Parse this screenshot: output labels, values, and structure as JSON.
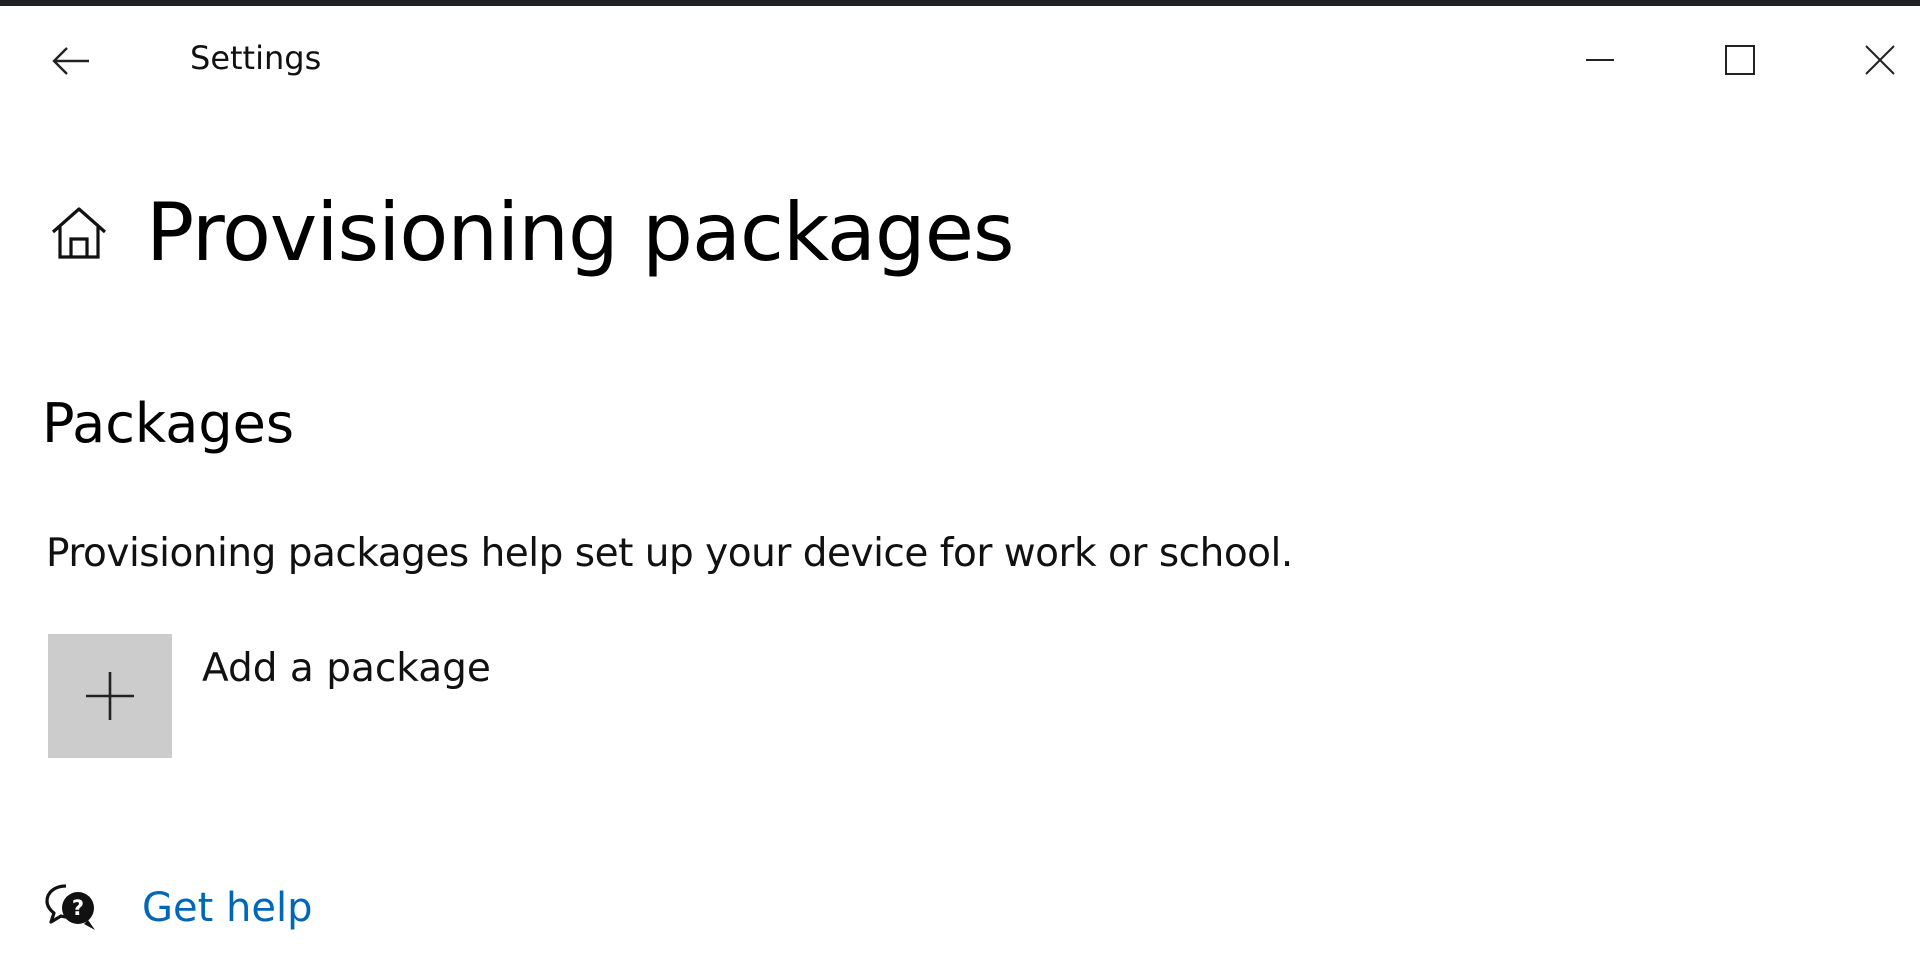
{
  "window": {
    "title": "Settings",
    "controls": {
      "minimize": "minimize-icon",
      "maximize": "maximize-icon",
      "close": "close-icon"
    }
  },
  "header": {
    "title": "Provisioning packages",
    "home_icon": "home-icon"
  },
  "section": {
    "title": "Packages",
    "description": "Provisioning packages help set up your device for work or school."
  },
  "add_package": {
    "label": "Add a package",
    "icon": "plus-icon"
  },
  "help": {
    "label": "Get help",
    "icon": "chat-help-icon"
  },
  "colors": {
    "link": "#0067b8",
    "tile": "#cccccc",
    "top_border": "#1f2124"
  }
}
